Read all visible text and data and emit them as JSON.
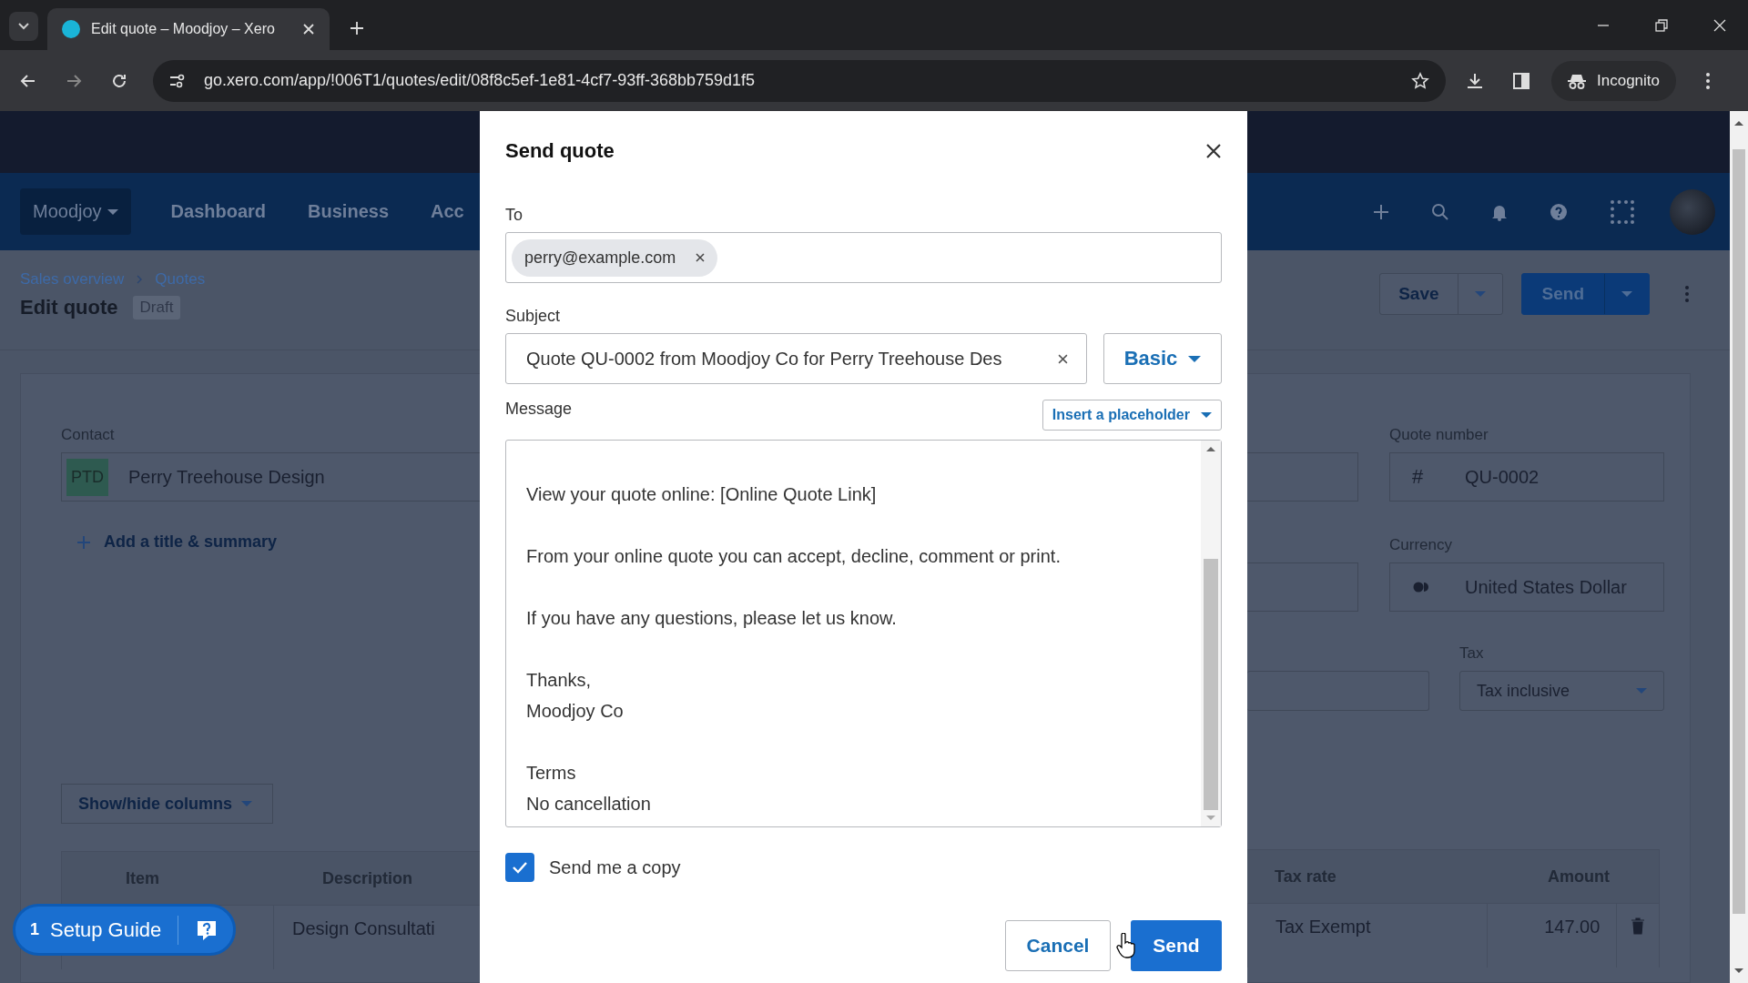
{
  "browser": {
    "tab_title": "Edit quote – Moodjoy – Xero",
    "url": "go.xero.com/app/!006T1/quotes/edit/08f8c5ef-1e81-4cf7-93ff-368bb759d1f5",
    "profile": "Incognito"
  },
  "app": {
    "org": "Moodjoy",
    "nav": [
      "Dashboard",
      "Business",
      "Acc"
    ],
    "breadcrumb": [
      "Sales overview",
      "Quotes"
    ],
    "page_title": "Edit quote",
    "status": "Draft",
    "save": "Save",
    "send": "Send"
  },
  "form": {
    "contact_label": "Contact",
    "contact_initials": "PTD",
    "contact_name": "Perry Treehouse Design",
    "add_title": "Add a title & summary",
    "quote_number_label": "Quote number",
    "quote_number_prefix": "#",
    "quote_number": "QU-0002",
    "currency_label": "Currency",
    "currency": "United States Dollar",
    "tax_label": "Tax",
    "tax": "Tax inclusive",
    "columns_button": "Show/hide columns"
  },
  "table": {
    "columns_left": [
      "Item",
      "Description"
    ],
    "columns_right": [
      "Tax rate",
      "Amount"
    ],
    "row": {
      "description": "Design Consultati",
      "tax_rate": "Tax Exempt",
      "amount": "147.00"
    }
  },
  "setup_guide": {
    "count": "1",
    "label": "Setup Guide"
  },
  "dialog": {
    "title": "Send quote",
    "to_label": "To",
    "recipients": [
      {
        "email": "perry@example.com"
      }
    ],
    "subject_label": "Subject",
    "subject": "Quote QU-0002 from Moodjoy Co for Perry Treehouse Des",
    "format": "Basic",
    "message_label": "Message",
    "placeholder_button": "Insert a placeholder",
    "message": [
      [
        "View your quote online: [Online Quote Link]"
      ],
      [
        "From your online quote you can accept, decline, comment or print."
      ],
      [
        "If you have any questions, please let us know."
      ],
      [
        "Thanks,",
        "Moodjoy Co"
      ],
      [
        "Terms",
        "No cancellation"
      ]
    ],
    "send_copy": {
      "label": "Send me a copy",
      "checked": true
    },
    "cancel": "Cancel",
    "send": "Send"
  }
}
